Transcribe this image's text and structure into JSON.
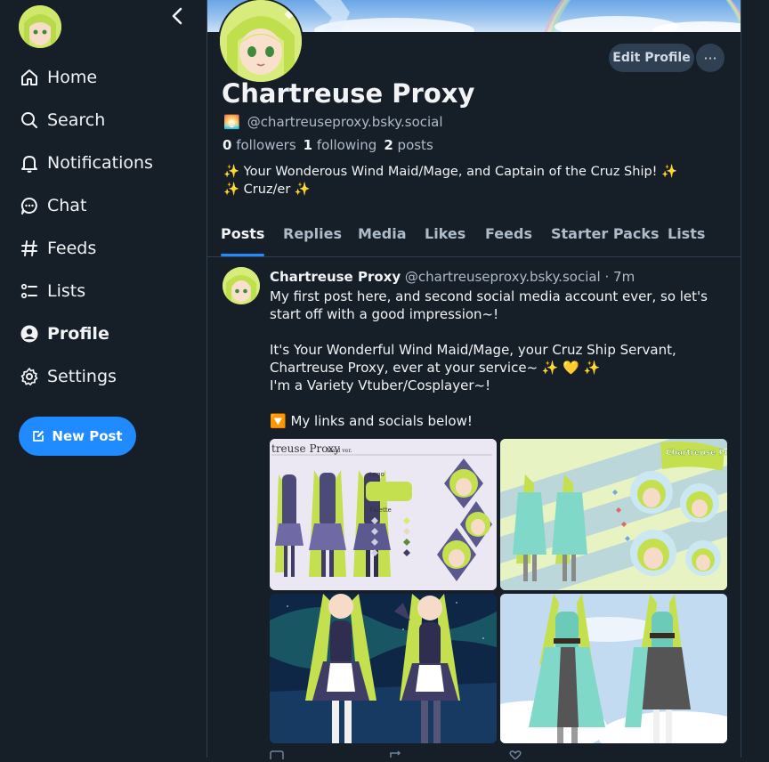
{
  "sidebar": {
    "items": [
      {
        "label": "Home",
        "icon": "home-icon"
      },
      {
        "label": "Search",
        "icon": "search-icon"
      },
      {
        "label": "Notifications",
        "icon": "bell-icon"
      },
      {
        "label": "Chat",
        "icon": "chat-icon"
      },
      {
        "label": "Feeds",
        "icon": "hash-icon"
      },
      {
        "label": "Lists",
        "icon": "list-icon"
      },
      {
        "label": "Profile",
        "icon": "user-circle-icon"
      },
      {
        "label": "Settings",
        "icon": "gear-icon"
      }
    ],
    "new_post_label": "New Post"
  },
  "profile": {
    "display_name": "Chartreuse Proxy",
    "handle": "@chartreuseproxy.bsky.social",
    "handle_emoji": "🌅",
    "followers_count": "0",
    "followers_label": "followers",
    "following_count": "1",
    "following_label": "following",
    "posts_count": "2",
    "posts_label": "posts",
    "bio": "✨ Your Wonderous Wind Maid/Mage, and Captain of the Cruz Ship! ✨\n✨ Cruz/er ✨",
    "edit_label": "Edit Profile",
    "more_label": "···"
  },
  "tabs": [
    "Posts",
    "Replies",
    "Media",
    "Likes",
    "Feeds",
    "Starter Packs",
    "Lists"
  ],
  "post": {
    "author": "Chartreuse Proxy",
    "handle": "@chartreuseproxy.bsky.social",
    "time": "· 7m",
    "text": "My first post here, and second social media account ever, so let's start off with a good impression~!\n\nIt's Your Wonderful Wind Maid/Mage, your Cruz Ship Servant, Chartreuse Proxy, ever at your service~ ✨ 💛 ✨\nI'm a Variety Vtuber/Cosplayer~!\n\n🔽 My links and socials below!",
    "images": [
      "Chartreuse Proxy Maid ver.",
      "Chartreuse Proxy"
    ],
    "image_texts": {
      "sheet1_title": "treuse Proxy",
      "sheet1_sub": "Maid ver.",
      "sheet1_logo": "Logo",
      "sheet1_palette": "Palette",
      "sheet2_logo": "Chartreuse Proxy"
    }
  },
  "colors": {
    "background": "#161e27",
    "accent": "#208bfe",
    "border": "#2e4052",
    "muted": "#aebbc9"
  }
}
